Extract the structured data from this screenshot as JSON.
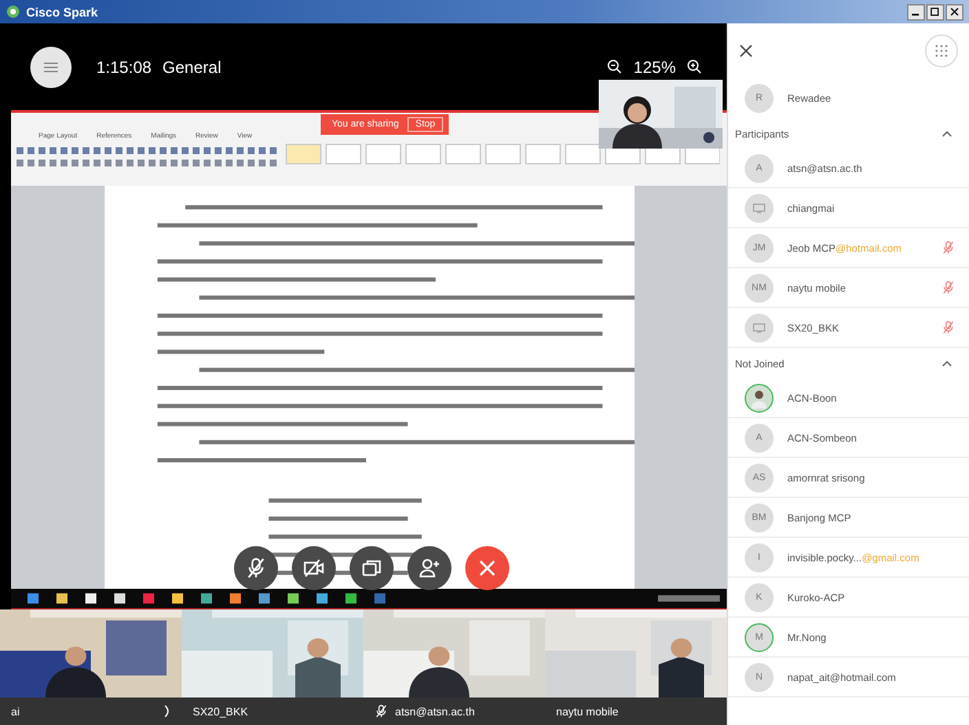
{
  "window": {
    "title": "Cisco Spark"
  },
  "call": {
    "duration": "1:15:08",
    "space": "General",
    "zoom": "125%"
  },
  "sharing": {
    "banner": "You are sharing",
    "stop": "Stop",
    "ribbon_tabs": [
      "Page Layout",
      "References",
      "Mailings",
      "Review",
      "View"
    ]
  },
  "controls": [
    {
      "kind": "mute"
    },
    {
      "kind": "video"
    },
    {
      "kind": "share"
    },
    {
      "kind": "add"
    },
    {
      "kind": "end"
    }
  ],
  "videos": [
    {
      "name": "ai",
      "kind": "speaking"
    },
    {
      "name": "SX20_BKK",
      "kind": "plain"
    },
    {
      "name": "atsn@atsn.ac.th",
      "kind": "muted"
    },
    {
      "name": "naytu mobile",
      "kind": "plain"
    }
  ],
  "panel": {
    "host": {
      "name": "Rewadee",
      "initials": "R"
    },
    "sections": [
      {
        "title": "Participants",
        "expanded": true,
        "people": [
          {
            "name": "atsn@atsn.ac.th",
            "kind": "initials",
            "initials": "A",
            "muted": false,
            "ring": false
          },
          {
            "name": "chiangmai",
            "kind": "device",
            "muted": false,
            "ring": false
          },
          {
            "name": "Jeob MCP",
            "highlight": "@hotmail.com",
            "kind": "initials",
            "initials": "JM",
            "muted": true,
            "ring": false
          },
          {
            "name": "naytu mobile",
            "kind": "initials",
            "initials": "NM",
            "muted": true,
            "ring": false
          },
          {
            "name": "SX20_BKK",
            "kind": "device",
            "muted": true,
            "ring": false
          }
        ]
      },
      {
        "title": "Not Joined",
        "expanded": true,
        "people": [
          {
            "name": "ACN-Boon",
            "muted": false,
            "ring": true
          },
          {
            "name": "ACN-Sombeon",
            "kind": "initials",
            "initials": "A",
            "muted": false,
            "ring": false
          },
          {
            "name": "amornrat srisong",
            "kind": "initials",
            "initials": "AS",
            "muted": false,
            "ring": false
          },
          {
            "name": "Banjong MCP",
            "kind": "initials",
            "initials": "BM",
            "muted": false,
            "ring": false
          },
          {
            "name": "invisible.pocky...",
            "highlight": "@gmail.com",
            "kind": "initials",
            "initials": "I",
            "muted": false,
            "ring": false
          },
          {
            "name": "Kuroko-ACP",
            "kind": "initials",
            "initials": "K",
            "muted": false,
            "ring": false
          },
          {
            "name": "Mr.Nong",
            "kind": "initials",
            "initials": "M",
            "muted": false,
            "ring": true
          },
          {
            "name": "napat_ait@hotmail.com",
            "kind": "initials",
            "initials": "N",
            "muted": false,
            "ring": false
          }
        ]
      }
    ]
  }
}
